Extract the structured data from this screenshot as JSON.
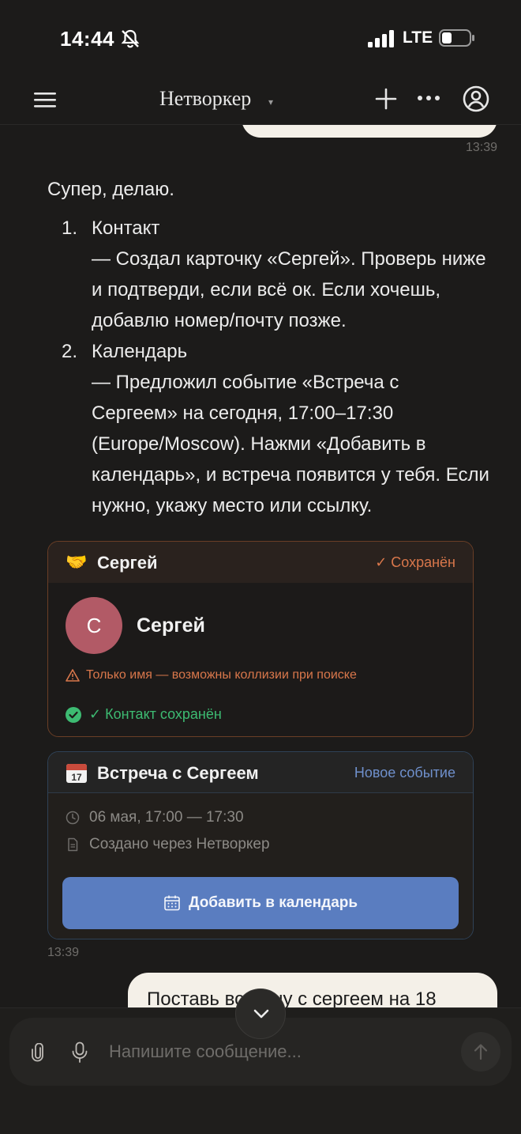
{
  "status_bar": {
    "time": "14:44",
    "network": "LTE"
  },
  "header": {
    "title": "Нетворкер",
    "chevron": "▾"
  },
  "messages": {
    "prev_timestamp": "13:39",
    "assistant": {
      "intro": "Супер, делаю.",
      "items": [
        {
          "num": "1.",
          "title": "Контакт",
          "body": "— Создал карточку «Сергей». Проверь ниже и подтверди, если всё ок. Если хочешь, добавлю номер/почту позже."
        },
        {
          "num": "2.",
          "title": "Календарь",
          "body": "— Предложил событие «Встреча с Сергеем» на сегодня, 17:00–17:30 (Europe/Moscow). Нажми «Добавить в календарь», и встреча появится у тебя. Если нужно, укажу место или ссылку."
        }
      ]
    },
    "contact_card": {
      "emoji": "🤝",
      "title": "Сергей",
      "status": "✓ Сохранён",
      "avatar_letter": "С",
      "name": "Сергей",
      "warning": "Только имя — возможны коллизии при поиске",
      "saved_text": "✓ Контакт сохранён",
      "accent_color": "#d9774b"
    },
    "event_card": {
      "title": "Встреча с Сергеем",
      "badge": "Новое событие",
      "time": "06 мая, 17:00 — 17:30",
      "created": "Создано через Нетворкер",
      "button_label": "Добавить в календарь",
      "button_color": "#5a7dc0"
    },
    "timestamp": "13:39",
    "user_message": "Поставь встречу с сергеем на 18"
  },
  "composer": {
    "placeholder": "Напишите сообщение..."
  },
  "icons": [
    "bell-slash-icon",
    "signal-icon",
    "battery-icon",
    "menu-icon",
    "plus-icon",
    "more-icon",
    "profile-icon",
    "warning-icon",
    "check-circle-icon",
    "calendar-icon",
    "clock-icon",
    "document-icon",
    "paperclip-icon",
    "microphone-icon",
    "send-arrow-icon",
    "chevron-down-icon"
  ]
}
